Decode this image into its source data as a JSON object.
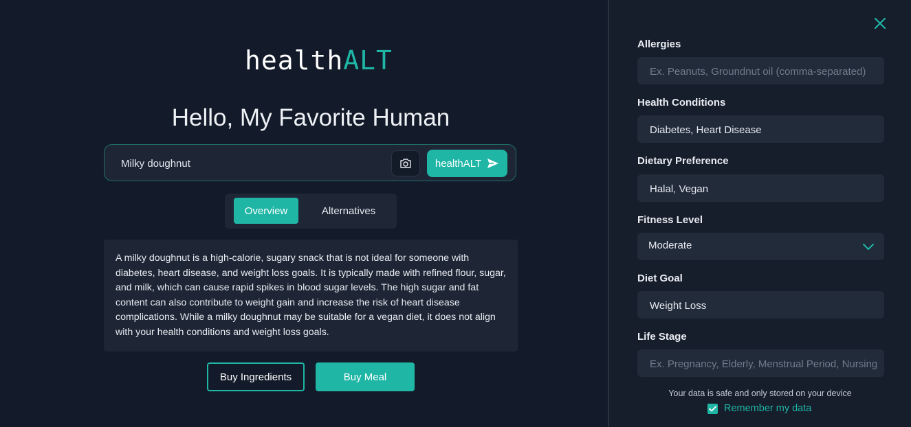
{
  "brand": {
    "part1": "health",
    "part2": "ALT"
  },
  "greeting": "Hello, My Favorite Human",
  "search": {
    "value": "Milky doughnut",
    "submit_label": "healthALT"
  },
  "tabs": [
    {
      "label": "Overview",
      "active": true
    },
    {
      "label": "Alternatives",
      "active": false
    }
  ],
  "overview_text": "A milky doughnut is a high-calorie, sugary snack that is not ideal for someone with diabetes, heart disease, and weight loss goals. It is typically made with refined flour, sugar, and milk, which can cause rapid spikes in blood sugar levels. The high sugar and fat content can also contribute to weight gain and increase the risk of heart disease complications. While a milky doughnut may be suitable for a vegan diet, it does not align with your health conditions and weight loss goals.",
  "actions": {
    "buy_ingredients": "Buy Ingredients",
    "buy_meal": "Buy Meal"
  },
  "profile": {
    "allergies": {
      "label": "Allergies",
      "value": "",
      "placeholder": "Ex. Peanuts, Groundnut oil (comma-separated)"
    },
    "health_conditions": {
      "label": "Health Conditions",
      "value": "Diabetes, Heart Disease",
      "placeholder": ""
    },
    "dietary_preference": {
      "label": "Dietary Preference",
      "value": "Halal, Vegan",
      "placeholder": ""
    },
    "fitness_level": {
      "label": "Fitness Level",
      "value": "Moderate"
    },
    "diet_goal": {
      "label": "Diet Goal",
      "value": "Weight Loss",
      "placeholder": ""
    },
    "life_stage": {
      "label": "Life Stage",
      "value": "",
      "placeholder": "Ex. Pregnancy, Elderly, Menstrual Period, Nursing"
    }
  },
  "privacy_note": "Your data is safe and only stored on your device",
  "remember": {
    "label": "Remember my data",
    "checked": true
  },
  "colors": {
    "accent": "#1fb6a5",
    "background": "#131a29",
    "panel": "#161d2b",
    "field": "#222b3a"
  },
  "icons": {
    "camera": "camera-icon",
    "send": "send-icon",
    "close": "close-icon",
    "chevron": "chevron-down-icon",
    "check": "check-icon"
  }
}
